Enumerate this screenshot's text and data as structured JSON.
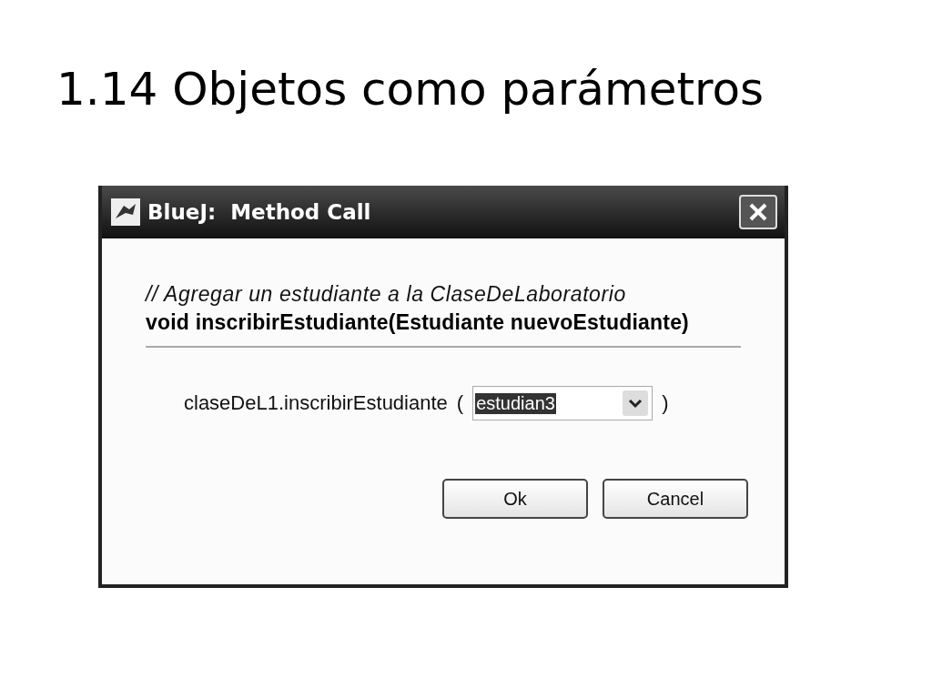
{
  "slide": {
    "title": "1.14 Objetos como parámetros"
  },
  "dialog": {
    "title": "BlueJ:  Method Call",
    "comment": "// Agregar un estudiante a la ClaseDeLaboratorio",
    "signature": "void inscribirEstudiante(Estudiante nuevoEstudiante)",
    "call_label": "claseDeL1.inscribirEstudiante",
    "open_paren": "(",
    "close_paren": ")",
    "argument": {
      "value": "estudian3",
      "selected": true
    },
    "buttons": [
      "Ok",
      "Cancel"
    ]
  }
}
